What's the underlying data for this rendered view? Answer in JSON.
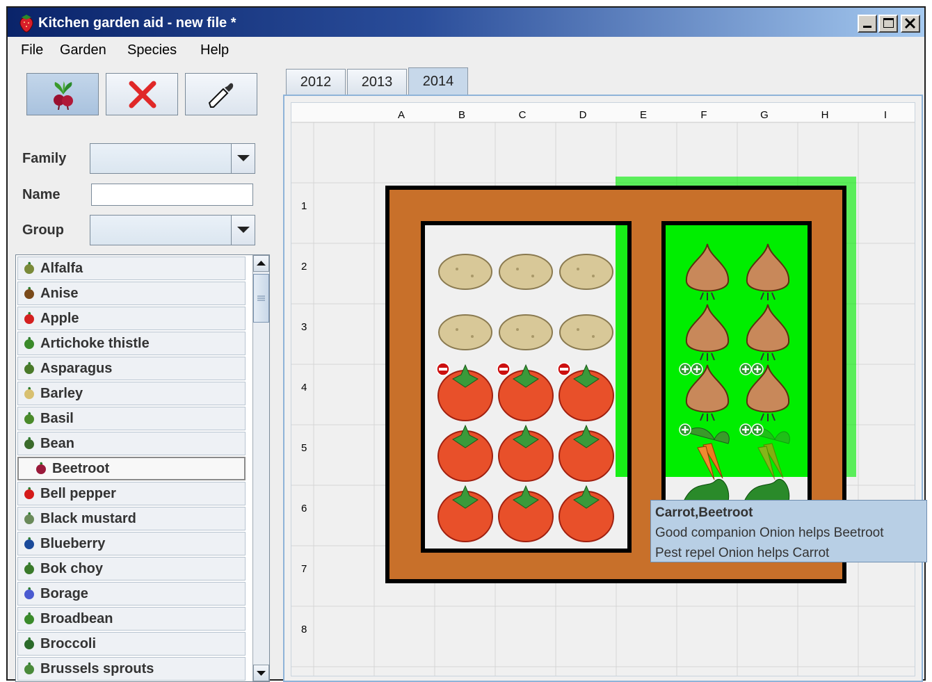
{
  "window": {
    "title": "Kitchen garden aid - new file *"
  },
  "menu": [
    "File",
    "Garden",
    "Species",
    "Help"
  ],
  "toolbar": {
    "plant_icon": "beetroot-plant-icon",
    "delete_icon": "red-x-icon",
    "picker_icon": "eyedropper-icon"
  },
  "filters": {
    "family_label": "Family",
    "family_value": "",
    "name_label": "Name",
    "name_value": "",
    "group_label": "Group",
    "group_value": ""
  },
  "species": [
    {
      "label": "Alfalfa",
      "icon": "alfalfa-icon",
      "color": "#7a8a3a"
    },
    {
      "label": "Anise",
      "icon": "anise-icon",
      "color": "#7a4a1a"
    },
    {
      "label": "Apple",
      "icon": "apple-icon",
      "color": "#d42020"
    },
    {
      "label": "Artichoke thistle",
      "icon": "artichoke-icon",
      "color": "#3a8a2a"
    },
    {
      "label": "Asparagus",
      "icon": "asparagus-icon",
      "color": "#4a7a2a"
    },
    {
      "label": "Barley",
      "icon": "barley-icon",
      "color": "#d8c070"
    },
    {
      "label": "Basil",
      "icon": "basil-icon",
      "color": "#4a8a2a"
    },
    {
      "label": "Bean",
      "icon": "bean-icon",
      "color": "#3a6a2a"
    },
    {
      "label": "Beetroot",
      "icon": "beetroot-icon",
      "color": "#9a1a3a"
    },
    {
      "label": "Bell pepper",
      "icon": "bell-pepper-icon",
      "color": "#d41a1a"
    },
    {
      "label": "Black mustard",
      "icon": "black-mustard-icon",
      "color": "#6a8a5a"
    },
    {
      "label": "Blueberry",
      "icon": "blueberry-icon",
      "color": "#1a4a9a"
    },
    {
      "label": "Bok choy",
      "icon": "bok-choy-icon",
      "color": "#3a7a2a"
    },
    {
      "label": "Borage",
      "icon": "borage-icon",
      "color": "#4a5ad0"
    },
    {
      "label": "Broadbean",
      "icon": "broadbean-icon",
      "color": "#3a8a2a"
    },
    {
      "label": "Broccoli",
      "icon": "broccoli-icon",
      "color": "#2a6a2a"
    },
    {
      "label": "Brussels sprouts",
      "icon": "brussels-sprouts-icon",
      "color": "#4a8a3a"
    }
  ],
  "selected_species": "Beetroot",
  "tabs": [
    "2012",
    "2013",
    "2014"
  ],
  "active_tab": "2014",
  "grid": {
    "columns": [
      "A",
      "B",
      "C",
      "D",
      "E",
      "F",
      "G",
      "H",
      "I"
    ],
    "rows": [
      "1",
      "2",
      "3",
      "4",
      "5",
      "6",
      "7",
      "8"
    ]
  },
  "colors": {
    "bed_frame": "#c8702a",
    "companion_green": "#00ee00",
    "window_title_start": "#0a246a",
    "tooltip_bg": "#b8cfe5"
  },
  "tooltip": {
    "title": "Carrot,Beetroot",
    "line1": "Good companion Onion helps Beetroot",
    "line2": "Pest repel Onion helps Carrot"
  }
}
